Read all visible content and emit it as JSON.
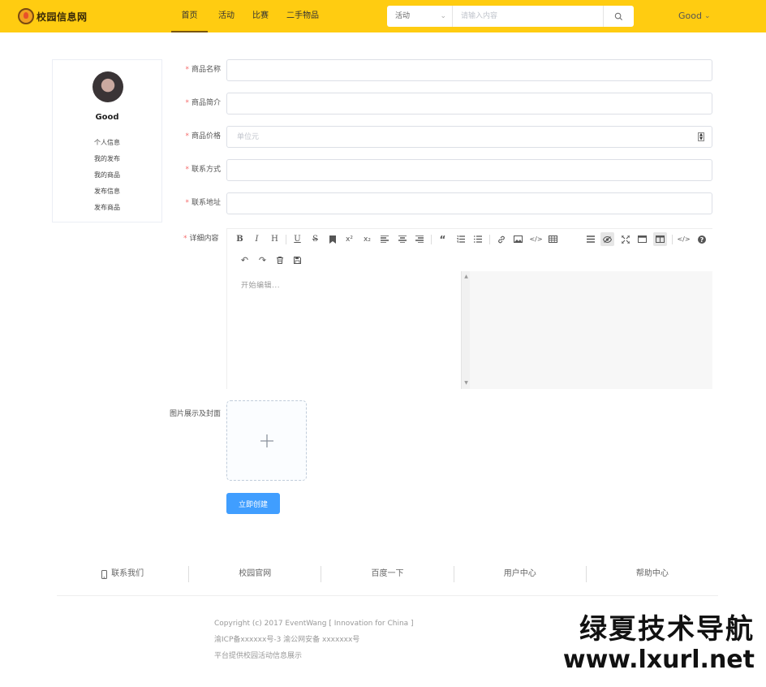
{
  "header": {
    "logo_text": "校园信息网",
    "nav": [
      {
        "label": "首页",
        "active": true
      },
      {
        "label": "活动",
        "active": false
      },
      {
        "label": "比赛",
        "active": false
      },
      {
        "label": "二手物品",
        "active": false
      }
    ],
    "search": {
      "category": "活动",
      "placeholder": "请输入内容",
      "value": ""
    },
    "user": "Good",
    "brand_color": "#ffcc11"
  },
  "sidebar": {
    "username": "Good",
    "links": [
      "个人信息",
      "我的发布",
      "我的商品",
      "发布信息",
      "发布商品"
    ]
  },
  "form": {
    "fields": [
      {
        "label": "商品名称",
        "required": true,
        "value": "",
        "placeholder": ""
      },
      {
        "label": "商品简介",
        "required": true,
        "value": "",
        "placeholder": ""
      },
      {
        "label": "商品价格",
        "required": true,
        "value": "",
        "placeholder": "单位元"
      },
      {
        "label": "联系方式",
        "required": true,
        "value": "",
        "placeholder": ""
      },
      {
        "label": "联系地址",
        "required": true,
        "value": "",
        "placeholder": ""
      }
    ],
    "editor_label": "详细内容",
    "editor_placeholder": "开始编辑...",
    "upload_label": "图片展示及封面",
    "submit_label": "立即创建",
    "required_mark": "*",
    "accent_color": "#409eff"
  },
  "footer": {
    "links": [
      "联系我们",
      "校园官网",
      "百度一下",
      "用户中心",
      "帮助中心"
    ],
    "copyright": [
      "Copyright (c) 2017 EventWang [ Innovation for China ]",
      "渝ICP备xxxxxx号-3 渝公网安备 xxxxxxx号",
      "平台提供校园活动信息展示"
    ]
  },
  "watermark": {
    "cn": "绿夏技术导航",
    "url": "www.lxurl.net"
  }
}
